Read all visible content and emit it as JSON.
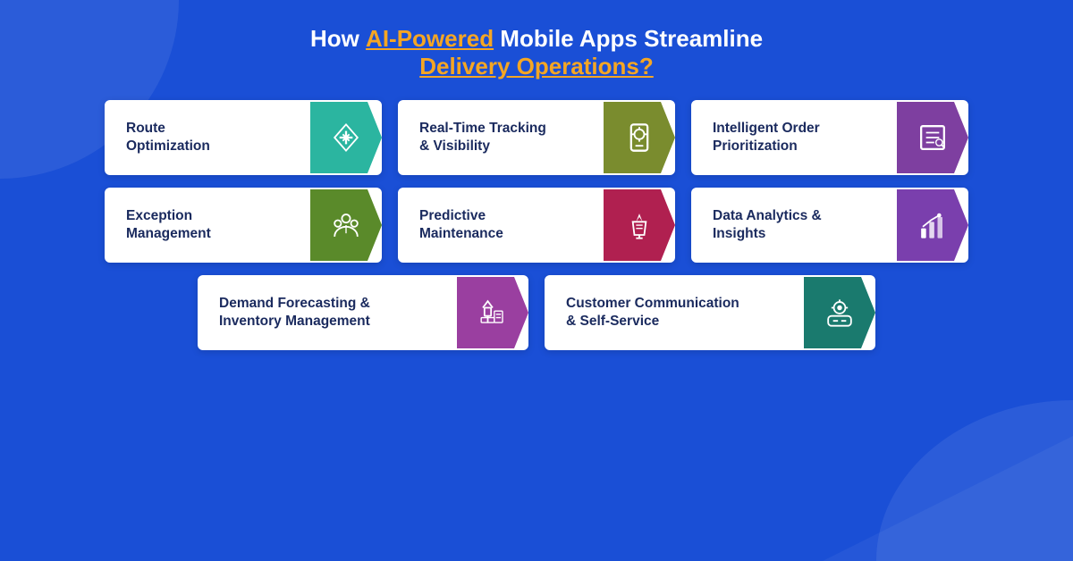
{
  "title": {
    "line1_prefix": "How ",
    "line1_highlight": "AI-Powered",
    "line1_suffix": " Mobile Apps Streamline",
    "line2": "Delivery Operations?"
  },
  "cards": {
    "row1": [
      {
        "id": "route-optimization",
        "label": "Route\nOptimization",
        "icon_color": "teal",
        "icon_name": "route-icon"
      },
      {
        "id": "realtime-tracking",
        "label": "Real-Time Tracking\n& Visibility",
        "icon_color": "olive",
        "icon_name": "tracking-icon"
      },
      {
        "id": "intelligent-order",
        "label": "Intelligent Order\nPrioritization",
        "icon_color": "purple",
        "icon_name": "order-icon"
      }
    ],
    "row2": [
      {
        "id": "exception-management",
        "label": "Exception\nManagement",
        "icon_color": "green",
        "icon_name": "exception-icon"
      },
      {
        "id": "predictive-maintenance",
        "label": "Predictive\nMaintenance",
        "icon_color": "crimson",
        "icon_name": "maintenance-icon"
      },
      {
        "id": "data-analytics",
        "label": "Data Analytics &\nInsights",
        "icon_color": "violet",
        "icon_name": "analytics-icon"
      }
    ],
    "row3": [
      {
        "id": "demand-forecasting",
        "label": "Demand Forecasting &\nInventory Management",
        "icon_color": "magenta",
        "icon_name": "forecasting-icon"
      },
      {
        "id": "customer-communication",
        "label": "Customer Communication\n& Self-Service",
        "icon_color": "teal2",
        "icon_name": "communication-icon"
      }
    ]
  }
}
